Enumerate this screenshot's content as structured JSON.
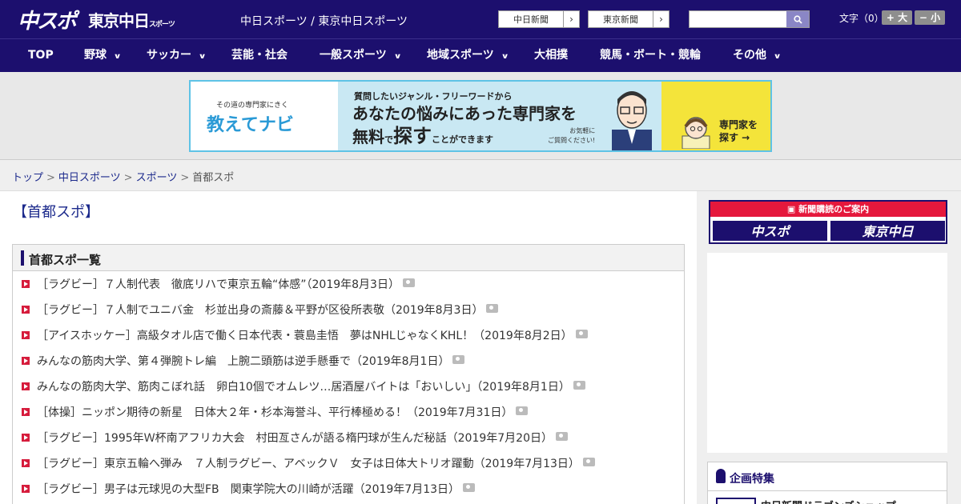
{
  "header": {
    "logo_chuspo": "中スポ",
    "logo_tokyo": "東京中日",
    "logo_tokyo_sub": "スポーツ",
    "title": "中日スポーツ / 東京中日スポーツ",
    "btn_chunichi": "中日新聞",
    "btn_tokyo": "東京新聞",
    "search_placeholder": "",
    "fontsize_label": "文字（0）",
    "font_up": "+ 大",
    "font_down": "− 小"
  },
  "nav": {
    "items": [
      {
        "label": "TOP",
        "dropdown": false
      },
      {
        "label": "野球",
        "dropdown": true
      },
      {
        "label": "サッカー",
        "dropdown": true
      },
      {
        "label": "芸能・社会",
        "dropdown": false
      },
      {
        "label": "一般スポーツ",
        "dropdown": true
      },
      {
        "label": "地域スポーツ",
        "dropdown": true
      },
      {
        "label": "大相撲",
        "dropdown": false
      },
      {
        "label": "競馬・ボート・競輪",
        "dropdown": false
      },
      {
        "label": "その他",
        "dropdown": true
      }
    ]
  },
  "banner": {
    "brand_small": "その道の専門家にきく",
    "brand_big": "教えてナビ",
    "line1": "質問したいジャンル・フリーワードから",
    "line2": "あなたの悩みにあった専門家を",
    "line3a": "無料",
    "line3b": "で",
    "line3c": "探す",
    "line3d": "ことができます",
    "note1": "お気軽に",
    "note2": "ご質問ください!",
    "cta1": "専門家を",
    "cta2": "探す →"
  },
  "breadcrumb": {
    "items": [
      "トップ",
      "中日スポーツ",
      "スポーツ"
    ],
    "current": "首都スポ"
  },
  "main": {
    "page_title": "【首都スポ】",
    "list_title": "首都スポ一覧",
    "articles": [
      "［ラグビー］７人制代表　徹底リハで東京五輪“体感”（2019年8月3日）",
      "［ラグビー］７人制でユニバ金　杉並出身の斎藤＆平野が区役所表敬（2019年8月3日）",
      "［アイスホッケー］高級タオル店で働く日本代表・蓑島圭悟　夢はNHLじゃなくKHL！（2019年8月2日）",
      "みんなの筋肉大学、第４弾腕トレ編　上腕二頭筋は逆手懸垂で（2019年8月1日）",
      "みんなの筋肉大学、筋肉こぼれ話　卵白10個でオムレツ…居酒屋バイトは「おいしい」（2019年8月1日）",
      "［体操］ニッポン期待の新星　日体大２年・杉本海誉斗、平行棒極める！（2019年7月31日）",
      "［ラグビー］1995年Ｗ杯南アフリカ大会　村田亙さんが語る楕円球が生んだ秘話（2019年7月20日）",
      "［ラグビー］東京五輪へ弾み　７人制ラグビー、アベックＶ　女子は日体大トリオ躍動（2019年7月13日）",
      "［ラグビー］男子は元球児の大型FB　関東学院大の川崎が活躍（2019年7月13日）"
    ]
  },
  "sidebar": {
    "subscribe_head": "新聞購読のご案内",
    "sub_chuspo": "中スポ",
    "sub_tokyo": "東京中日",
    "kikaku_title": "企画特集",
    "kikaku_item": "中日新聞ドラゴンズショップ"
  },
  "colors": {
    "brand_navy": "#1c0f6e",
    "accent_red": "#e5183c",
    "link_blue": "#1c2a8c"
  }
}
